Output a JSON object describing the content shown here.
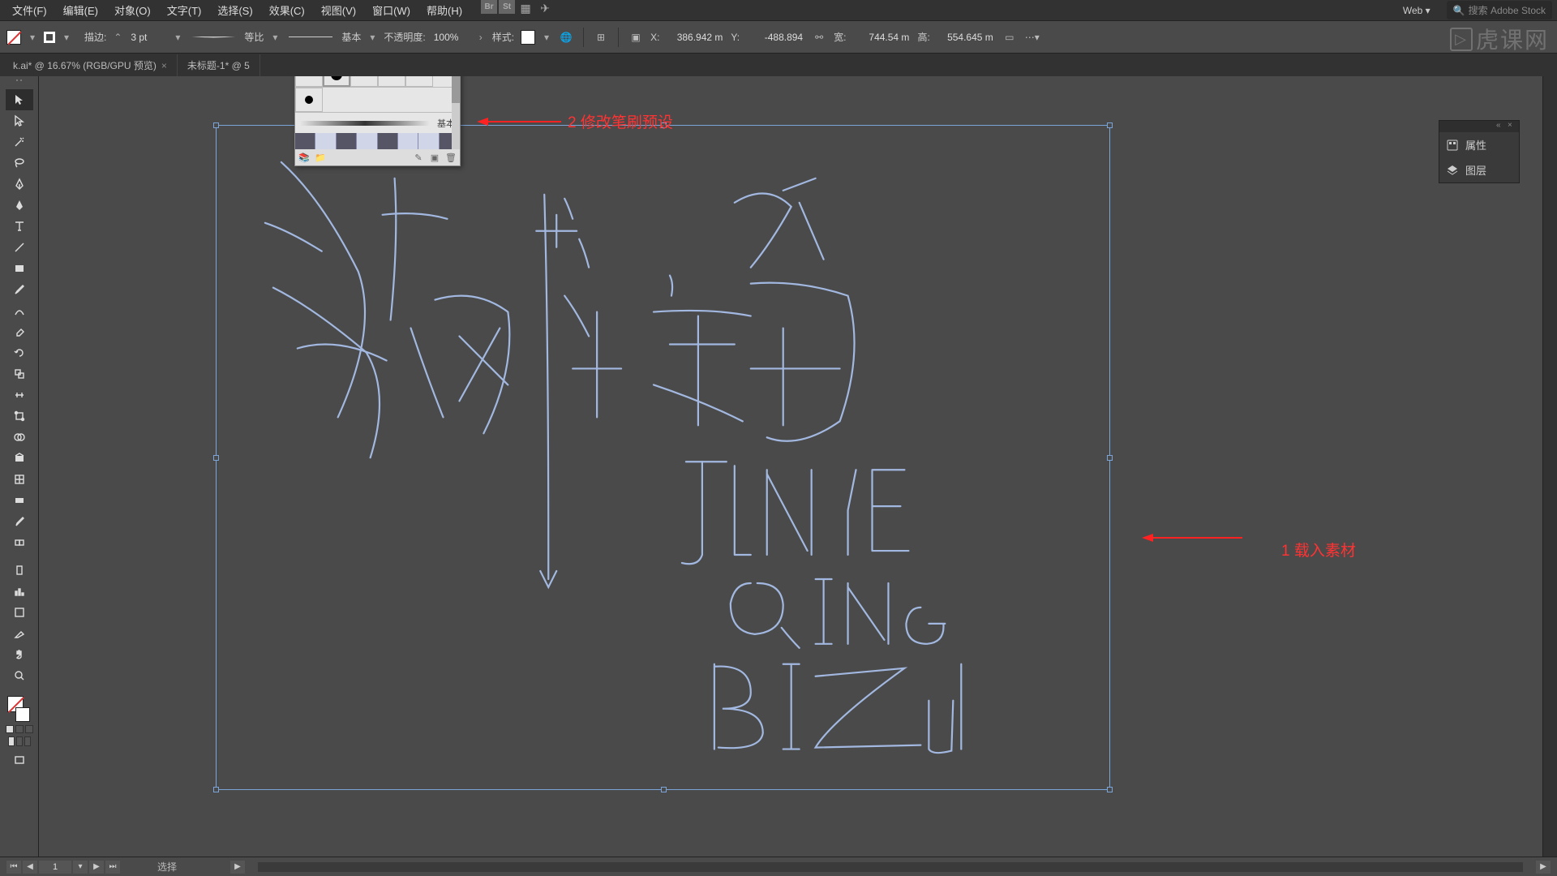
{
  "menu": {
    "items": [
      "文件(F)",
      "编辑(E)",
      "对象(O)",
      "文字(T)",
      "选择(S)",
      "效果(C)",
      "视图(V)",
      "窗口(W)",
      "帮助(H)"
    ],
    "workspace": "Web",
    "search_placeholder": "搜索 Adobe Stock"
  },
  "control": {
    "stroke_label": "描边:",
    "stroke_size": "3 pt",
    "profile_label": "等比",
    "brush_label": "基本",
    "opacity_label": "不透明度:",
    "opacity_value": "100%",
    "style_label": "样式:",
    "x_label": "X:",
    "x_value": "386.942 m",
    "y_label": "Y:",
    "y_value": "-488.894",
    "w_label": "宽:",
    "w_value": "744.54 m",
    "h_label": "高:",
    "h_value": "554.645 m"
  },
  "tabs": {
    "t1": "k.ai* @ 16.67% (RGB/GPU 预览)",
    "t2": "未标题-1* @ 5"
  },
  "brush_popup": {
    "label": "基本"
  },
  "annotations": {
    "a1": "1 载入素材",
    "a2": "2 修改笔刷预设"
  },
  "right_panel": {
    "i1": "属性",
    "i2": "图层"
  },
  "status": {
    "page": "1",
    "tool": "选择"
  },
  "watermark": "虎课网"
}
